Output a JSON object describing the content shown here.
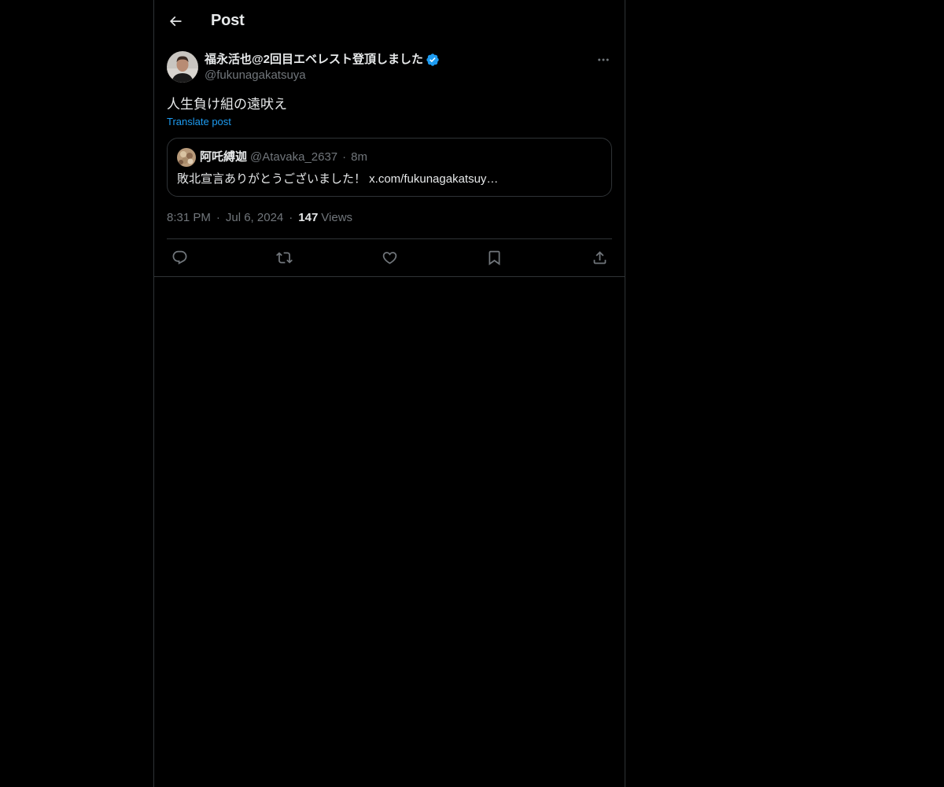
{
  "header": {
    "title": "Post",
    "back_icon": "arrow-left-icon"
  },
  "post": {
    "author": {
      "display_name": "福永活也@2回目エベレスト登頂しました",
      "handle": "@fukunagakatsuya",
      "verified": true,
      "verified_color": "#1d9bf0"
    },
    "text": "人生負け組の遠吠え",
    "translate_label": "Translate post",
    "quote": {
      "display_name": "阿吒縛迦",
      "handle": "@Atavaka_2637",
      "separator": "·",
      "time": "8m",
      "text": "敗北宣言ありがとうございました！ x.com/fukunagakatsuy…"
    },
    "meta": {
      "time": "8:31 PM",
      "separator": "·",
      "date": "Jul 6, 2024",
      "views_count": "147",
      "views_label": "Views"
    },
    "actions": [
      {
        "name": "reply-icon"
      },
      {
        "name": "repost-icon"
      },
      {
        "name": "like-icon"
      },
      {
        "name": "bookmark-icon"
      },
      {
        "name": "share-icon"
      }
    ]
  },
  "colors": {
    "background": "#000000",
    "text_primary": "#e7e9ea",
    "text_secondary": "#71767b",
    "accent": "#1d9bf0",
    "border": "#2f3336"
  }
}
